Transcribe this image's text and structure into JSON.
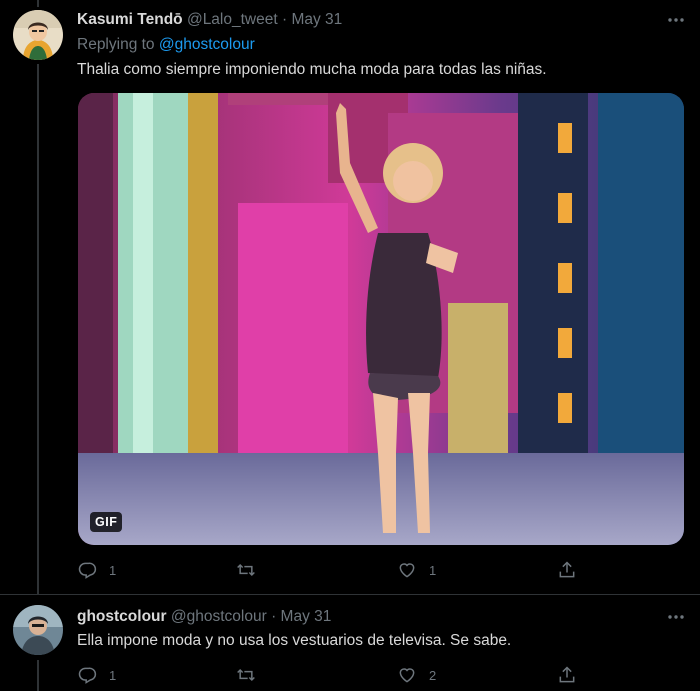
{
  "tweets": [
    {
      "display_name": "Kasumi Tendō",
      "handle": "@Lalo_tweet",
      "separator": "·",
      "date": "May 31",
      "replying_prefix": "Replying to ",
      "replying_to": "@ghostcolour",
      "text": "Thalia como siempre imponiendo mucha moda para todas las niñas.",
      "media": {
        "type": "gif",
        "badge": "GIF"
      },
      "actions": {
        "reply_count": "1",
        "retweet_count": "",
        "like_count": "1"
      }
    },
    {
      "display_name": "ghostcolour",
      "handle": "@ghostcolour",
      "separator": "·",
      "date": "May 31",
      "text": "Ella impone moda y no usa los vestuarios de televisa. Se sabe.",
      "actions": {
        "reply_count": "1",
        "retweet_count": "",
        "like_count": "2"
      }
    }
  ],
  "more_icon": "more-horizontal-icon",
  "colors": {
    "background": "#000000",
    "text_primary": "#d9d9d9",
    "text_secondary": "#6e767d",
    "link": "#1d9bf0",
    "divider": "#2f3336"
  }
}
